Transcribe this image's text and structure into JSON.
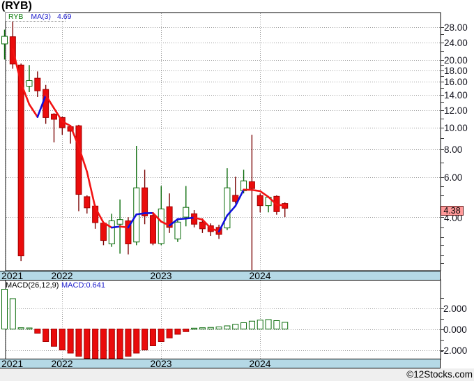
{
  "page": {
    "title": "(RYB)",
    "copyright": "©12Stocks.com"
  },
  "main_chart": {
    "legend": {
      "symbol": "RYB",
      "ma_label": "MA(3)",
      "ma_value": "4.69"
    },
    "last_price_tag": "4.38",
    "covered_axis_label": "4.00",
    "y_axis_labels": [
      "28.00",
      "24.00",
      "20.00",
      "18.00",
      "16.00",
      "14.00",
      "12.00",
      "10.00",
      "8.00",
      "6.00"
    ],
    "y_axis_values": [
      28,
      24,
      20,
      18,
      16,
      14,
      12,
      10,
      8,
      6
    ],
    "y_axis_minor_ticks": [
      26,
      22,
      19,
      17,
      15,
      13,
      11,
      9,
      7,
      5.5,
      5,
      4.5,
      3.6,
      3.25,
      3.0,
      2.7,
      2.5
    ],
    "x_year_labels": [
      "2021",
      "2022",
      "2023",
      "2024"
    ]
  },
  "macd_panel": {
    "indicator_label": "MACD(26,12,9)",
    "value_label": "MACD:0.641",
    "y_axis_labels": [
      "2.000",
      "0.000",
      "-2.000"
    ],
    "y_axis_values": [
      2,
      0,
      -2
    ],
    "x_year_labels": [
      "2021",
      "2022",
      "2023",
      "2024"
    ]
  },
  "chart_data": [
    {
      "type": "candlestick",
      "symbol": "RYB",
      "interval": "monthly",
      "y_scale": "log",
      "title": "(RYB)",
      "x_year_labels": [
        "2021",
        "2022",
        "2023",
        "2024"
      ],
      "x_year_gridline_indices": [
        7,
        19,
        31
      ],
      "y_ticks": [
        28,
        24,
        20,
        18,
        16,
        14,
        12,
        10,
        8,
        6,
        4
      ],
      "ma_period": 3,
      "ma_last": 4.69,
      "last_close": 4.38,
      "ohlc": [
        [
          23.6,
          27.3,
          20.1,
          25.5
        ],
        [
          25.4,
          29.9,
          18.3,
          19.2
        ],
        [
          19.0,
          19.3,
          2.55,
          2.69
        ],
        [
          15.3,
          19.0,
          14.4,
          16.2
        ],
        [
          16.6,
          17.8,
          13.7,
          14.6
        ],
        [
          14.8,
          15.5,
          10.4,
          11.1
        ],
        [
          11.5,
          11.6,
          8.6,
          10.9
        ],
        [
          11.1,
          11.2,
          9.3,
          10.0
        ],
        [
          10.1,
          10.2,
          8.5,
          9.65
        ],
        [
          10.2,
          10.3,
          4.25,
          5.05
        ],
        [
          4.93,
          5.0,
          4.15,
          4.4
        ],
        [
          4.48,
          4.55,
          3.55,
          3.78
        ],
        [
          3.76,
          3.8,
          3.0,
          3.15
        ],
        [
          3.04,
          4.14,
          2.95,
          3.85
        ],
        [
          3.72,
          4.79,
          2.75,
          3.9
        ],
        [
          3.85,
          4.0,
          2.73,
          3.04
        ],
        [
          3.1,
          8.3,
          3.0,
          5.4
        ],
        [
          5.4,
          6.5,
          3.72,
          4.05
        ],
        [
          4.07,
          4.2,
          3.0,
          3.06
        ],
        [
          3.05,
          5.5,
          3.0,
          4.35
        ],
        [
          4.45,
          5.1,
          3.4,
          3.6
        ],
        [
          3.2,
          3.95,
          3.1,
          3.8
        ],
        [
          4.0,
          5.5,
          3.64,
          4.42
        ],
        [
          4.14,
          4.3,
          3.6,
          3.72
        ],
        [
          3.8,
          3.95,
          3.4,
          3.55
        ],
        [
          3.66,
          3.75,
          3.3,
          3.45
        ],
        [
          3.6,
          3.7,
          3.2,
          3.35
        ],
        [
          3.58,
          6.6,
          3.5,
          5.4
        ],
        [
          5.0,
          6.05,
          4.6,
          4.7
        ],
        [
          5.24,
          6.5,
          5.1,
          5.8
        ],
        [
          5.75,
          9.3,
          2.32,
          5.36
        ],
        [
          4.99,
          5.1,
          4.2,
          4.5
        ],
        [
          4.5,
          4.95,
          4.2,
          4.9
        ],
        [
          4.95,
          5.0,
          4.1,
          4.23
        ],
        [
          4.6,
          4.65,
          4.0,
          4.38
        ]
      ]
    },
    {
      "type": "bar",
      "name": "MACD(26,12,9)",
      "last": 0.641,
      "y_ticks": [
        2,
        0,
        -2
      ],
      "values": [
        3.8,
        2.9,
        0.12,
        0.1,
        -0.4,
        -1.2,
        -1.65,
        -2.0,
        -2.3,
        -2.6,
        -2.8,
        -2.95,
        -3.05,
        -3.0,
        -2.85,
        -2.6,
        -2.3,
        -2.0,
        -1.6,
        -1.2,
        -0.85,
        -0.5,
        -0.25,
        0.08,
        0.12,
        0.15,
        0.2,
        0.3,
        0.45,
        0.6,
        0.75,
        0.85,
        0.9,
        0.8,
        0.641
      ]
    }
  ],
  "colors": {
    "up": "#0a6b0a",
    "down_fill": "#ea0c0c",
    "down_stroke": "#a30000",
    "down_wick": "#7b0505",
    "ma_up": "#1010dd",
    "ma_down": "#f21212",
    "band": "#b5d9e6",
    "tag_bg": "#ff9a9a",
    "grid": "#9a9a9a"
  }
}
